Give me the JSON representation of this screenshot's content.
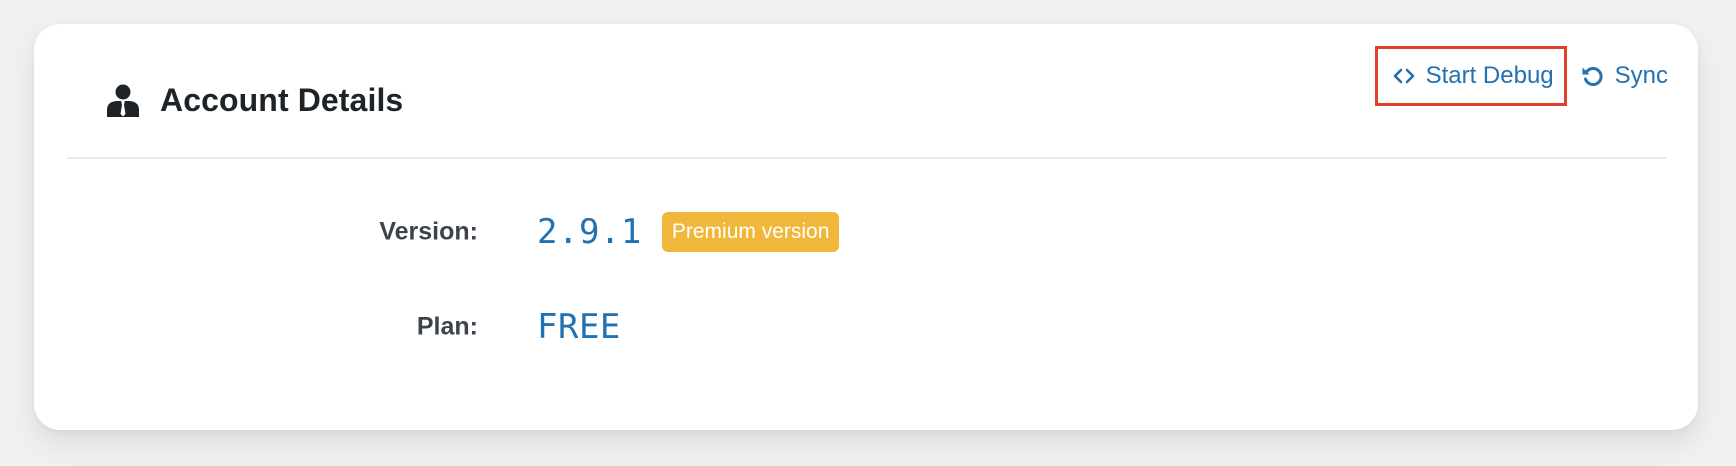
{
  "header": {
    "title": "Account Details",
    "title_icon": "user-icon"
  },
  "actions": {
    "debug_label": "Start Debug",
    "debug_icon": "code-icon",
    "sync_label": "Sync",
    "sync_icon": "refresh-icon"
  },
  "details": {
    "version_label": "Version:",
    "version_value": "2.9.1",
    "version_badge": "Premium version",
    "plan_label": "Plan:",
    "plan_value": "FREE"
  },
  "colors": {
    "accent": "#2271b1",
    "badge": "#f0b73a",
    "highlight_border": "#e0412a"
  }
}
